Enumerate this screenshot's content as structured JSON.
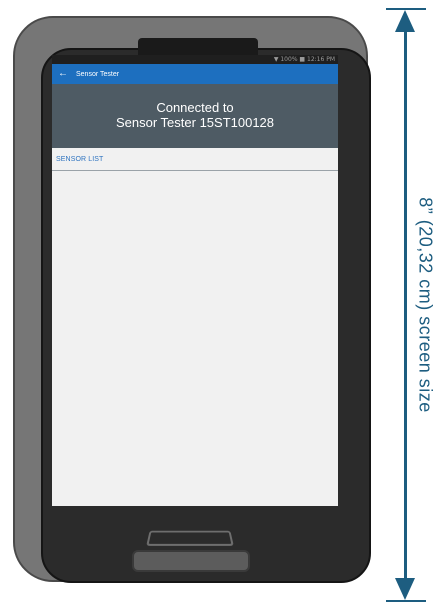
{
  "device": {
    "status_bar": "▼ 100% ■ 12:16 PM"
  },
  "app": {
    "title": "Sensor Tester",
    "header_line1": "Connected to",
    "header_line2": "Sensor Tester 15ST100128",
    "section_label": "SENSOR LIST"
  },
  "dimension": {
    "label": "8” (20,32 cm) screen size"
  },
  "colors": {
    "app_bar": "#1d6fbf",
    "header": "#4e5b64",
    "accent_text": "#2f74c0",
    "dimension": "#1d5d80"
  },
  "icons": {
    "back": "arrow-left-icon"
  }
}
